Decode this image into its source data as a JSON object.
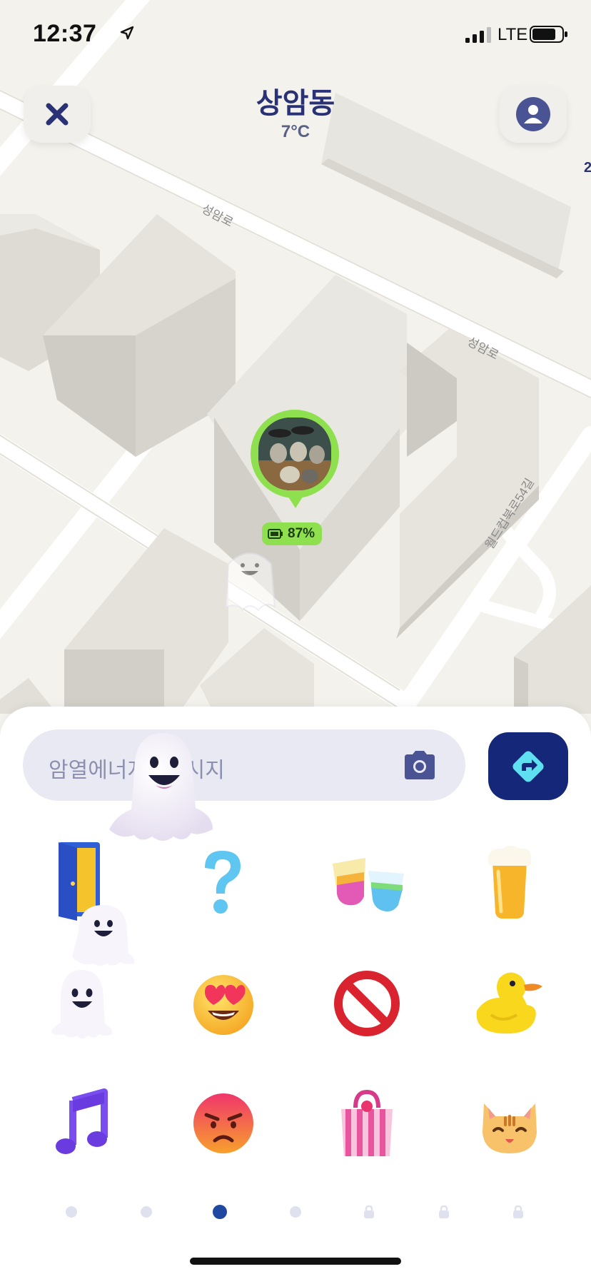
{
  "status_bar": {
    "time": "12:37",
    "network": "LTE"
  },
  "header": {
    "place_name": "상암동",
    "temperature": "7°C",
    "close_icon": "close-icon",
    "profile_icon": "profile-icon"
  },
  "map": {
    "street_labels": [
      "성암로",
      "성암로",
      "월드컵북로54길"
    ],
    "edge_label": "2",
    "friend_pin": {
      "battery_percent": "87%"
    }
  },
  "composer": {
    "placeholder_left": "암열에너지",
    "placeholder_right": "메시지",
    "camera_icon": "camera-icon",
    "send_icon": "send-direction-icon"
  },
  "emoji_grid": [
    {
      "name": "door-emoji"
    },
    {
      "name": "question-mark-emoji"
    },
    {
      "name": "cocktail-glasses-emoji"
    },
    {
      "name": "beer-emoji"
    },
    {
      "name": "ghost-emoji"
    },
    {
      "name": "heart-eyes-emoji"
    },
    {
      "name": "prohibited-emoji"
    },
    {
      "name": "rubber-duck-emoji"
    },
    {
      "name": "music-note-emoji"
    },
    {
      "name": "angry-face-emoji"
    },
    {
      "name": "shopping-bag-emoji"
    },
    {
      "name": "cat-face-emoji"
    }
  ],
  "pager": {
    "pages": 7,
    "active_page": 3,
    "locked_pages": [
      5,
      6,
      7
    ]
  },
  "colors": {
    "accent": "#142779",
    "title": "#2a3275",
    "pin_green": "#8ee04f",
    "active_dot": "#2148a0"
  }
}
